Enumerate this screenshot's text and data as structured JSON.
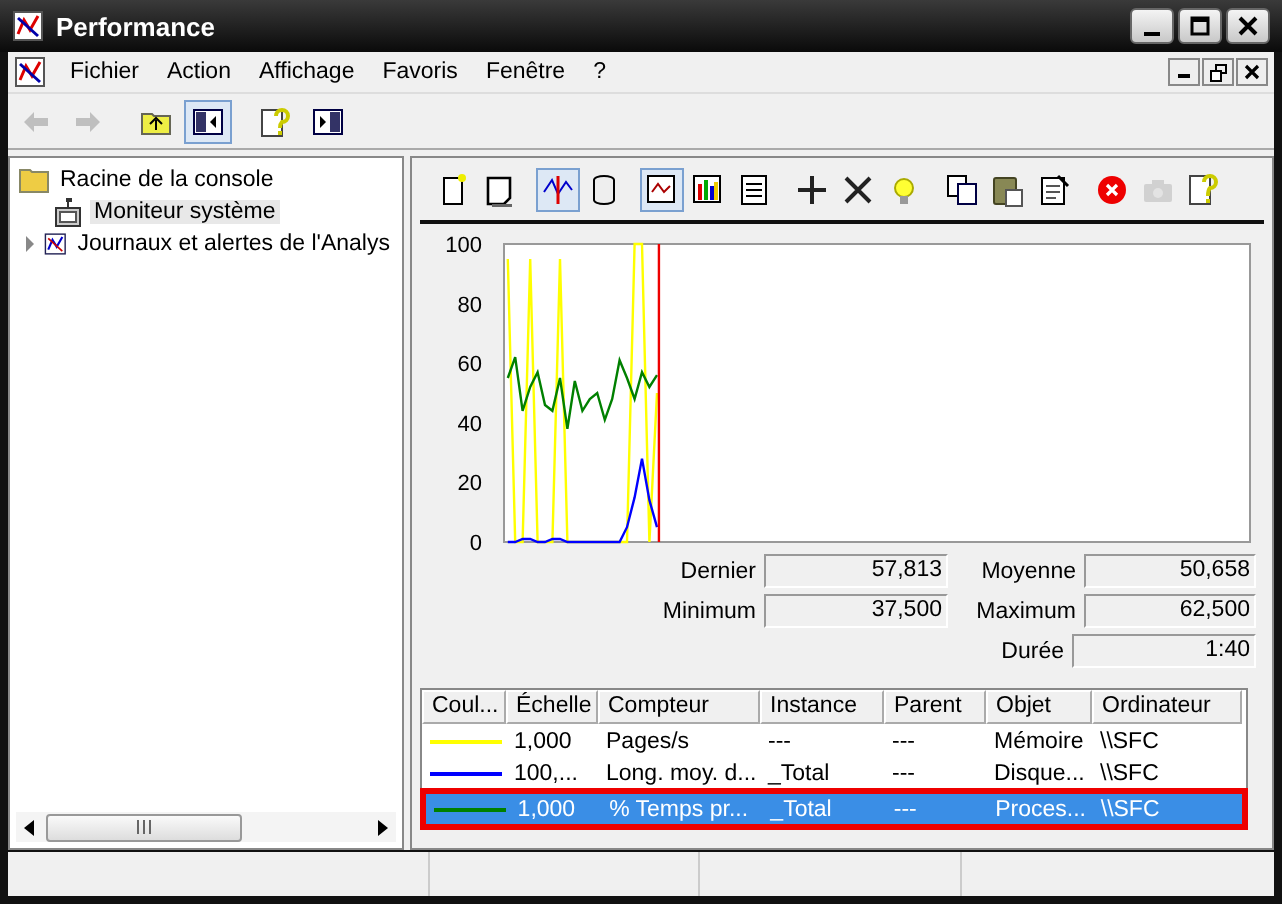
{
  "window": {
    "title": "Performance"
  },
  "menu": [
    "Fichier",
    "Action",
    "Affichage",
    "Favoris",
    "Fenêtre",
    "?"
  ],
  "main_toolbar": [
    {
      "disabled": true,
      "pressed": false
    },
    {
      "disabled": true,
      "pressed": false
    },
    {
      "disabled": false,
      "pressed": false
    },
    {
      "disabled": false,
      "pressed": true
    },
    {
      "disabled": false,
      "pressed": false
    },
    {
      "disabled": false,
      "pressed": false
    }
  ],
  "tree": {
    "label": "Racine de la console",
    "selected": false,
    "children": [
      {
        "label": "Moniteur système",
        "selected": true
      },
      {
        "label": "Journaux et alertes de l'Analys",
        "selected": false,
        "expanded": false
      }
    ]
  },
  "graph_toolbar": [
    {
      "pressed": false,
      "disabled": false
    },
    {
      "pressed": false,
      "disabled": false
    },
    {
      "pressed": true,
      "disabled": false
    },
    {
      "pressed": false,
      "disabled": false
    },
    {
      "pressed": true,
      "disabled": false
    },
    {
      "pressed": false,
      "disabled": false
    },
    {
      "pressed": false,
      "disabled": false
    },
    {
      "pressed": false,
      "disabled": false
    },
    {
      "pressed": false,
      "disabled": false
    },
    {
      "pressed": false,
      "disabled": false
    },
    {
      "pressed": false,
      "disabled": false
    },
    {
      "pressed": false,
      "disabled": false
    },
    {
      "pressed": false,
      "disabled": false
    },
    {
      "pressed": false,
      "disabled": false
    },
    {
      "pressed": false,
      "disabled": true
    },
    {
      "pressed": false,
      "disabled": false
    }
  ],
  "graph": {
    "y_axis_labels": [
      "100",
      "80",
      "60",
      "40",
      "20",
      "0"
    ]
  },
  "stats": [
    {
      "label": "Dernier",
      "value": "57,813"
    },
    {
      "label": "Moyenne",
      "value": "50,658"
    },
    {
      "label": "Minimum",
      "value": "37,500"
    },
    {
      "label": "Maximum",
      "value": "62,500"
    },
    {
      "label": "Durée",
      "value": "1:40"
    }
  ],
  "counters": {
    "columns": [
      "Coul...",
      "Échelle",
      "Compteur",
      "Instance",
      "Parent",
      "Objet",
      "Ordinateur"
    ],
    "rows": [
      {
        "color": "#ffff00",
        "cells": [
          "",
          "1,000",
          "Pages/s",
          "---",
          "---",
          "Mémoire",
          "\\\\SFC"
        ],
        "selected": false
      },
      {
        "color": "#0000ff",
        "cells": [
          "",
          "100,...",
          "Long. moy. d...",
          "_Total",
          "---",
          "Disque...",
          "\\\\SFC"
        ],
        "selected": false
      },
      {
        "color": "#008000",
        "cells": [
          "",
          "1,000",
          "% Temps pr...",
          "_Total",
          "---",
          "Proces...",
          "\\\\SFC"
        ],
        "selected": true
      }
    ]
  }
}
